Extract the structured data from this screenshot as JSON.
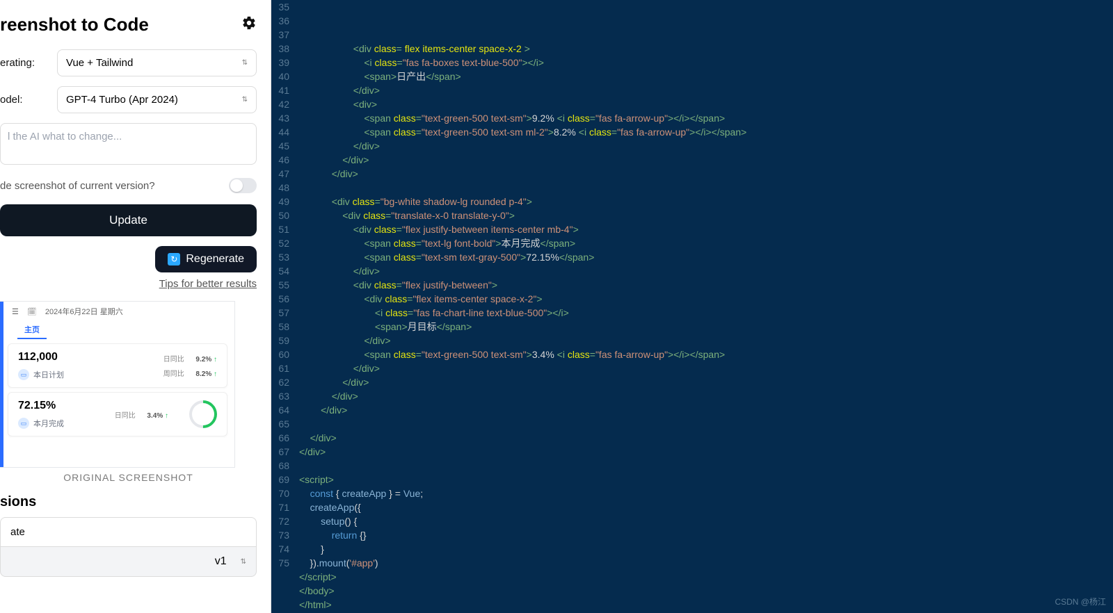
{
  "app": {
    "title": "reenshot to Code"
  },
  "form": {
    "gen_label": "erating:",
    "gen_value": "Vue + Tailwind",
    "model_label": "odel:",
    "model_value": "GPT-4 Turbo (Apr 2024)",
    "prompt_placeholder": "l the AI what to change...",
    "include_label": "de screenshot of current version?",
    "update_btn": "Update",
    "regen_btn": "Regenerate",
    "tips": "Tips for better results"
  },
  "preview": {
    "date": "2024年6月22日 星期六",
    "tab": "主页",
    "card1": {
      "value": "112,000",
      "sub": "本日计划",
      "r1_l": "日同比",
      "r1_v": "9.2%",
      "r2_l": "周同比",
      "r2_v": "8.2%"
    },
    "card2": {
      "value": "72.15%",
      "sub": "本月完成",
      "r1_l": "日同比",
      "r1_v": "3.4%"
    },
    "orig_label": "ORIGINAL SCREENSHOT"
  },
  "versions": {
    "title": "sions",
    "item1": "ate",
    "item2": "v1"
  },
  "code": {
    "start": 35,
    "lines": [
      [
        [
          "w",
          "                    "
        ],
        [
          "g",
          "<div"
        ],
        [
          "w",
          " "
        ],
        [
          "y",
          "class"
        ],
        [
          "g",
          "="
        ],
        [
          "w",
          " "
        ],
        [
          "y",
          "flex items-center space-x-2"
        ],
        [
          "w",
          " "
        ],
        [
          "g",
          ">"
        ]
      ],
      [
        [
          "w",
          "                        "
        ],
        [
          "g",
          "<i"
        ],
        [
          "w",
          " "
        ],
        [
          "y",
          "class"
        ],
        [
          "g",
          "="
        ],
        [
          "s",
          "\"fas fa-boxes text-blue-500\""
        ],
        [
          "g",
          "></i>"
        ]
      ],
      [
        [
          "w",
          "                        "
        ],
        [
          "g",
          "<span>"
        ],
        [
          "w",
          "日产出"
        ],
        [
          "g",
          "</span>"
        ]
      ],
      [
        [
          "w",
          "                    "
        ],
        [
          "g",
          "</div>"
        ]
      ],
      [
        [
          "w",
          "                    "
        ],
        [
          "g",
          "<div>"
        ]
      ],
      [
        [
          "w",
          "                        "
        ],
        [
          "g",
          "<span"
        ],
        [
          "w",
          " "
        ],
        [
          "y",
          "class"
        ],
        [
          "g",
          "="
        ],
        [
          "s",
          "\"text-green-500 text-sm\""
        ],
        [
          "g",
          ">"
        ],
        [
          "w",
          "9.2% "
        ],
        [
          "g",
          "<i"
        ],
        [
          "w",
          " "
        ],
        [
          "y",
          "class"
        ],
        [
          "g",
          "="
        ],
        [
          "s",
          "\"fas fa-arrow-up\""
        ],
        [
          "g",
          "></i></span>"
        ]
      ],
      [
        [
          "w",
          "                        "
        ],
        [
          "g",
          "<span"
        ],
        [
          "w",
          " "
        ],
        [
          "y",
          "class"
        ],
        [
          "g",
          "="
        ],
        [
          "s",
          "\"text-green-500 text-sm ml-2\""
        ],
        [
          "g",
          ">"
        ],
        [
          "w",
          "8.2% "
        ],
        [
          "g",
          "<i"
        ],
        [
          "w",
          " "
        ],
        [
          "y",
          "class"
        ],
        [
          "g",
          "="
        ],
        [
          "s",
          "\"fas fa-arrow-up\""
        ],
        [
          "g",
          "></i></span>"
        ]
      ],
      [
        [
          "w",
          "                    "
        ],
        [
          "g",
          "</div>"
        ]
      ],
      [
        [
          "w",
          "                "
        ],
        [
          "g",
          "</div>"
        ]
      ],
      [
        [
          "w",
          "            "
        ],
        [
          "g",
          "</div>"
        ]
      ],
      [
        [
          "w",
          ""
        ]
      ],
      [
        [
          "w",
          "            "
        ],
        [
          "g",
          "<div"
        ],
        [
          "w",
          " "
        ],
        [
          "y",
          "class"
        ],
        [
          "g",
          "="
        ],
        [
          "s",
          "\"bg-white shadow-lg rounded p-4\""
        ],
        [
          "g",
          ">"
        ]
      ],
      [
        [
          "w",
          "                "
        ],
        [
          "g",
          "<div"
        ],
        [
          "w",
          " "
        ],
        [
          "y",
          "class"
        ],
        [
          "g",
          "="
        ],
        [
          "s",
          "\"translate-x-0 translate-y-0\""
        ],
        [
          "g",
          ">"
        ]
      ],
      [
        [
          "w",
          "                    "
        ],
        [
          "g",
          "<div"
        ],
        [
          "w",
          " "
        ],
        [
          "y",
          "class"
        ],
        [
          "g",
          "="
        ],
        [
          "s",
          "\"flex justify-between items-center mb-4\""
        ],
        [
          "g",
          ">"
        ]
      ],
      [
        [
          "w",
          "                        "
        ],
        [
          "g",
          "<span"
        ],
        [
          "w",
          " "
        ],
        [
          "y",
          "class"
        ],
        [
          "g",
          "="
        ],
        [
          "s",
          "\"text-lg font-bold\""
        ],
        [
          "g",
          ">"
        ],
        [
          "w",
          "本月完成"
        ],
        [
          "g",
          "</span>"
        ]
      ],
      [
        [
          "w",
          "                        "
        ],
        [
          "g",
          "<span"
        ],
        [
          "w",
          " "
        ],
        [
          "y",
          "class"
        ],
        [
          "g",
          "="
        ],
        [
          "s",
          "\"text-sm text-gray-500\""
        ],
        [
          "g",
          ">"
        ],
        [
          "w",
          "72.15%"
        ],
        [
          "g",
          "</span>"
        ]
      ],
      [
        [
          "w",
          "                    "
        ],
        [
          "g",
          "</div>"
        ]
      ],
      [
        [
          "w",
          "                    "
        ],
        [
          "g",
          "<div"
        ],
        [
          "w",
          " "
        ],
        [
          "y",
          "class"
        ],
        [
          "g",
          "="
        ],
        [
          "s",
          "\"flex justify-between\""
        ],
        [
          "g",
          ">"
        ]
      ],
      [
        [
          "w",
          "                        "
        ],
        [
          "g",
          "<div"
        ],
        [
          "w",
          " "
        ],
        [
          "y",
          "class"
        ],
        [
          "g",
          "="
        ],
        [
          "s",
          "\"flex items-center space-x-2\""
        ],
        [
          "g",
          ">"
        ]
      ],
      [
        [
          "w",
          "                            "
        ],
        [
          "g",
          "<i"
        ],
        [
          "w",
          " "
        ],
        [
          "y",
          "class"
        ],
        [
          "g",
          "="
        ],
        [
          "s",
          "\"fas fa-chart-line text-blue-500\""
        ],
        [
          "g",
          "></i>"
        ]
      ],
      [
        [
          "w",
          "                            "
        ],
        [
          "g",
          "<span>"
        ],
        [
          "w",
          "月目标"
        ],
        [
          "g",
          "</span>"
        ]
      ],
      [
        [
          "w",
          "                        "
        ],
        [
          "g",
          "</div>"
        ]
      ],
      [
        [
          "w",
          "                        "
        ],
        [
          "g",
          "<span"
        ],
        [
          "w",
          " "
        ],
        [
          "y",
          "class"
        ],
        [
          "g",
          "="
        ],
        [
          "s",
          "\"text-green-500 text-sm\""
        ],
        [
          "g",
          ">"
        ],
        [
          "w",
          "3.4% "
        ],
        [
          "g",
          "<i"
        ],
        [
          "w",
          " "
        ],
        [
          "y",
          "class"
        ],
        [
          "g",
          "="
        ],
        [
          "s",
          "\"fas fa-arrow-up\""
        ],
        [
          "g",
          "></i></span>"
        ]
      ],
      [
        [
          "w",
          "                    "
        ],
        [
          "g",
          "</div>"
        ]
      ],
      [
        [
          "w",
          "                "
        ],
        [
          "g",
          "</div>"
        ]
      ],
      [
        [
          "w",
          "            "
        ],
        [
          "g",
          "</div>"
        ]
      ],
      [
        [
          "w",
          "        "
        ],
        [
          "g",
          "</div>"
        ]
      ],
      [
        [
          "w",
          ""
        ]
      ],
      [
        [
          "w",
          "    "
        ],
        [
          "g",
          "</div>"
        ]
      ],
      [
        [
          "g",
          "</div>"
        ]
      ],
      [
        [
          "w",
          ""
        ]
      ],
      [
        [
          "g",
          "<script>"
        ]
      ],
      [
        [
          "w",
          "    "
        ],
        [
          "c",
          "const"
        ],
        [
          "w",
          " { "
        ],
        [
          "b",
          "createApp"
        ],
        [
          "w",
          " } = "
        ],
        [
          "b",
          "Vue"
        ],
        [
          "w",
          ";"
        ]
      ],
      [
        [
          "w",
          "    "
        ],
        [
          "b",
          "createApp"
        ],
        [
          "w",
          "({"
        ]
      ],
      [
        [
          "w",
          "        "
        ],
        [
          "b",
          "setup"
        ],
        [
          "w",
          "() {"
        ]
      ],
      [
        [
          "w",
          "            "
        ],
        [
          "c",
          "return"
        ],
        [
          "w",
          " {}"
        ]
      ],
      [
        [
          "w",
          "        }"
        ]
      ],
      [
        [
          "w",
          "    })."
        ],
        [
          "b",
          "mount"
        ],
        [
          "w",
          "("
        ],
        [
          "s",
          "'#app'"
        ],
        [
          "w",
          ")"
        ]
      ],
      [
        [
          "g",
          "</script>"
        ]
      ],
      [
        [
          "g",
          "</body>"
        ]
      ],
      [
        [
          "g",
          "</html>"
        ]
      ]
    ]
  },
  "watermark": "CSDN @杨江"
}
